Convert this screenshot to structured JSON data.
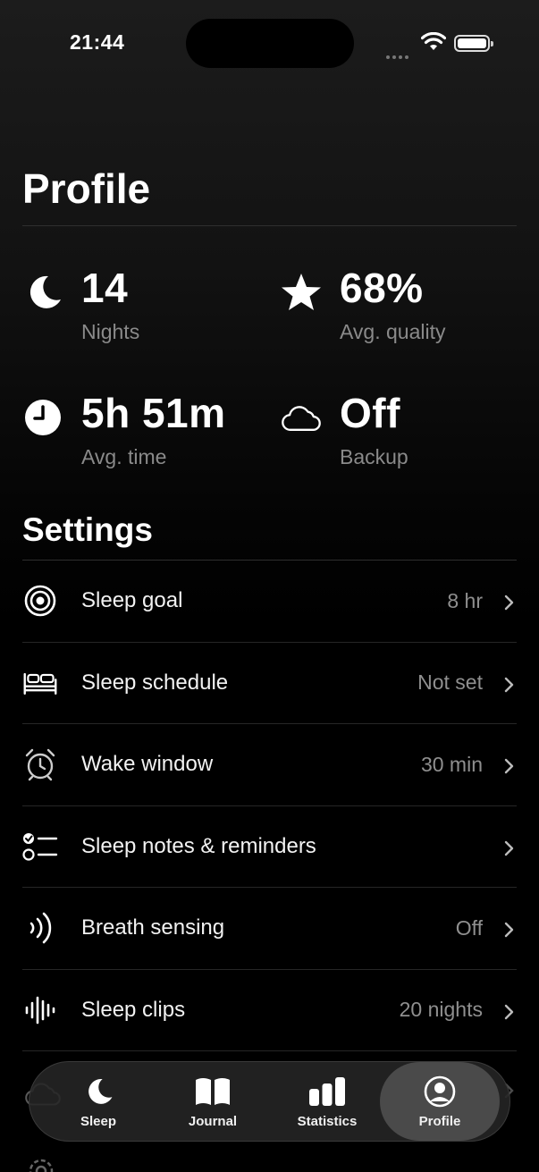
{
  "status_bar": {
    "time": "21:44"
  },
  "header": {
    "title": "Profile"
  },
  "stats": [
    {
      "value": "14",
      "label": "Nights",
      "icon": "moon-icon"
    },
    {
      "value": "68%",
      "label": "Avg. quality",
      "icon": "star-icon"
    },
    {
      "value": "5h 51m",
      "label": "Avg. time",
      "icon": "clock-icon"
    },
    {
      "value": "Off",
      "label": "Backup",
      "icon": "cloud-icon"
    }
  ],
  "settings": {
    "title": "Settings",
    "items": [
      {
        "label": "Sleep goal",
        "value": "8 hr",
        "icon": "target-icon"
      },
      {
        "label": "Sleep schedule",
        "value": "Not set",
        "icon": "bed-icon"
      },
      {
        "label": "Wake window",
        "value": "30 min",
        "icon": "alarm-clock-icon"
      },
      {
        "label": "Sleep notes & reminders",
        "value": "",
        "icon": "checklist-icon"
      },
      {
        "label": "Breath sensing",
        "value": "Off",
        "icon": "breath-waves-icon"
      },
      {
        "label": "Sleep clips",
        "value": "20 nights",
        "icon": "waveform-icon"
      }
    ]
  },
  "tabbar": {
    "tabs": [
      {
        "label": "Sleep",
        "icon": "moon-icon",
        "active": false
      },
      {
        "label": "Journal",
        "icon": "book-icon",
        "active": false
      },
      {
        "label": "Statistics",
        "icon": "bar-chart-icon",
        "active": false
      },
      {
        "label": "Profile",
        "icon": "person-circle-icon",
        "active": true
      }
    ]
  },
  "colors": {
    "background": "#000000",
    "text": "#ffffff",
    "secondary_text": "#8a8a8a",
    "divider": "#2e2e2e",
    "tabbar": "#262626",
    "active_tab": "#4a4a4a"
  }
}
